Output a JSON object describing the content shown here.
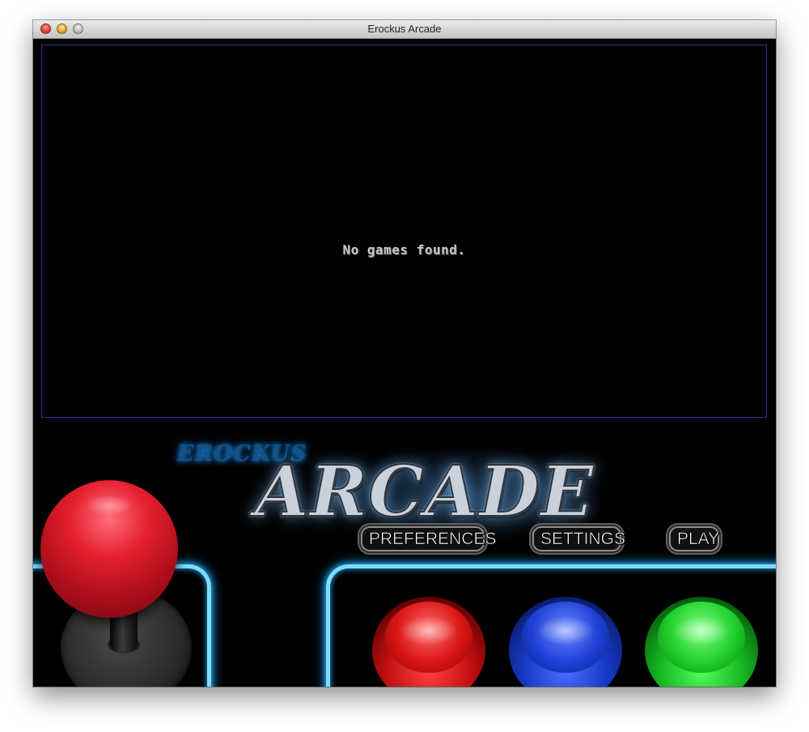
{
  "window": {
    "title": "Erockus Arcade"
  },
  "game_list": {
    "empty_message": "No games found."
  },
  "branding": {
    "small": "EROCKUS",
    "large": "ARCADE"
  },
  "panel_buttons": {
    "preferences": "PREFERENCES",
    "settings": "SETTINGS",
    "play": "PLAY"
  },
  "colors": {
    "neon": "#7fdcff",
    "screen_border": "#2a3a9a",
    "joystick_ball": "#e6202f",
    "button_red": "#d81414",
    "button_blue": "#1e3fd6",
    "button_green": "#1fcf2a"
  }
}
